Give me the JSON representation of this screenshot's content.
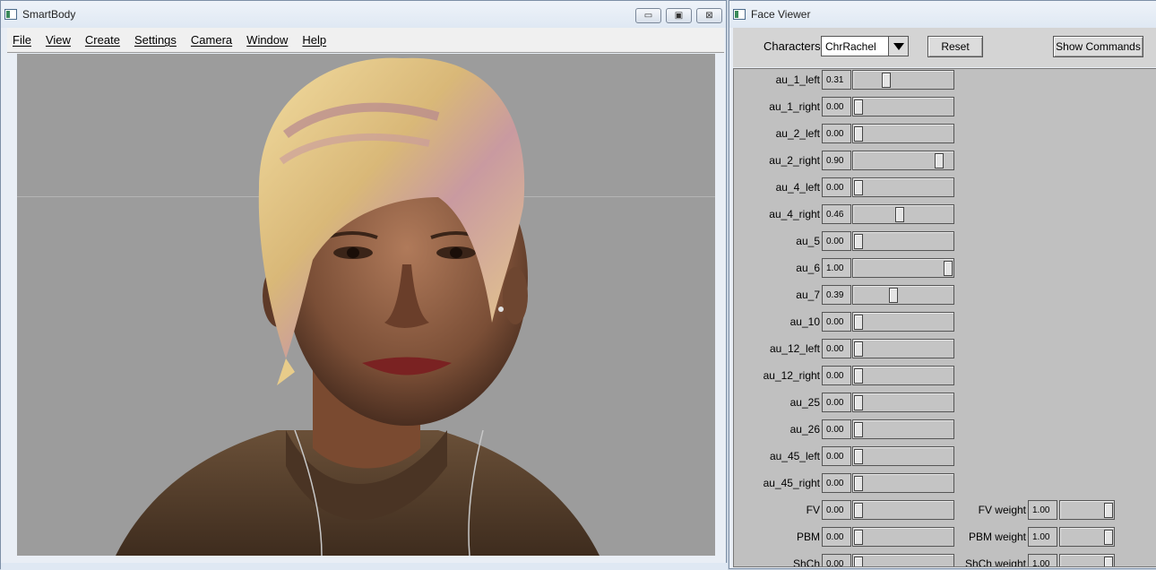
{
  "smartbody": {
    "title": "SmartBody",
    "menu": [
      "File",
      "View",
      "Create",
      "Settings",
      "Camera",
      "Window",
      "Help"
    ],
    "window_buttons": {
      "minimize": "▭",
      "maximize": "▣",
      "close": "⊠"
    }
  },
  "face_viewer": {
    "title": "Face Viewer",
    "characters_label": "Characters",
    "character_value": "ChrRachel",
    "reset_label": "Reset",
    "show_commands_label": "Show Commands",
    "sliders": [
      {
        "name": "au_1_left",
        "value": "0.31",
        "level": 0.31
      },
      {
        "name": "au_1_right",
        "value": "0.00",
        "level": 0.0
      },
      {
        "name": "au_2_left",
        "value": "0.00",
        "level": 0.0
      },
      {
        "name": "au_2_right",
        "value": "0.90",
        "level": 0.9
      },
      {
        "name": "au_4_left",
        "value": "0.00",
        "level": 0.0
      },
      {
        "name": "au_4_right",
        "value": "0.46",
        "level": 0.46
      },
      {
        "name": "au_5",
        "value": "0.00",
        "level": 0.0
      },
      {
        "name": "au_6",
        "value": "1.00",
        "level": 1.0
      },
      {
        "name": "au_7",
        "value": "0.39",
        "level": 0.39
      },
      {
        "name": "au_10",
        "value": "0.00",
        "level": 0.0
      },
      {
        "name": "au_12_left",
        "value": "0.00",
        "level": 0.0
      },
      {
        "name": "au_12_right",
        "value": "0.00",
        "level": 0.0
      },
      {
        "name": "au_25",
        "value": "0.00",
        "level": 0.0
      },
      {
        "name": "au_26",
        "value": "0.00",
        "level": 0.0
      },
      {
        "name": "au_45_left",
        "value": "0.00",
        "level": 0.0
      },
      {
        "name": "au_45_right",
        "value": "0.00",
        "level": 0.0
      },
      {
        "name": "FV",
        "value": "0.00",
        "level": 0.0,
        "weight_label": "FV weight",
        "weight_value": "1.00",
        "weight_level": 1.0
      },
      {
        "name": "PBM",
        "value": "0.00",
        "level": 0.0,
        "weight_label": "PBM weight",
        "weight_value": "1.00",
        "weight_level": 1.0
      },
      {
        "name": "ShCh",
        "value": "0.00",
        "level": 0.0,
        "weight_label": "ShCh weight",
        "weight_value": "1.00",
        "weight_level": 1.0
      }
    ]
  }
}
